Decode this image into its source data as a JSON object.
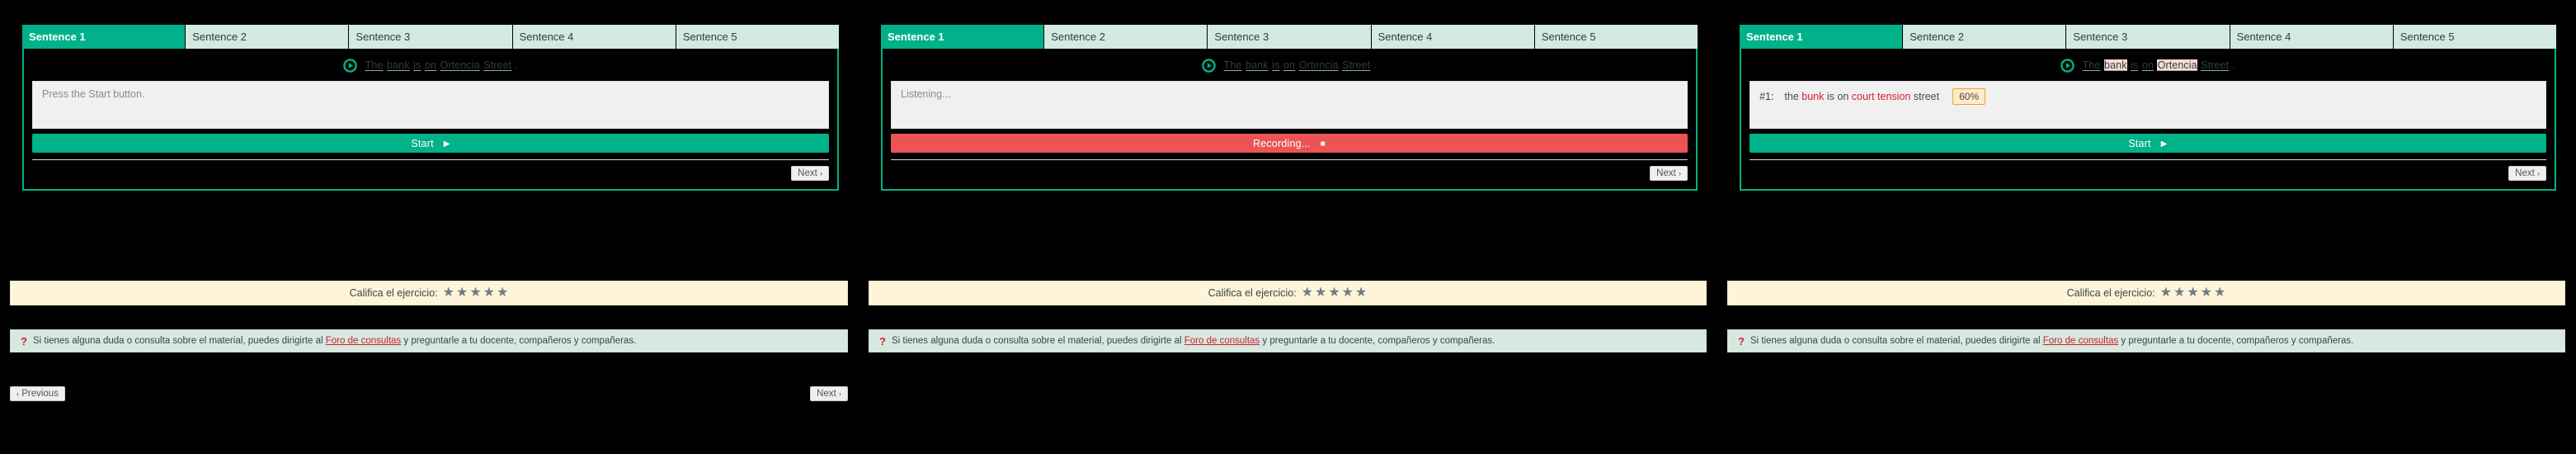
{
  "tabs": [
    {
      "label": "Sentence 1",
      "active": true
    },
    {
      "label": "Sentence 2",
      "active": false
    },
    {
      "label": "Sentence 3",
      "active": false
    },
    {
      "label": "Sentence 4",
      "active": false
    },
    {
      "label": "Sentence 5",
      "active": false
    }
  ],
  "prompt": {
    "play_icon": "play-circle-icon",
    "full_text": "The bank is on Ortencia Street .",
    "words": [
      "The",
      "bank",
      "is",
      "on",
      "Ortencia",
      "Street"
    ],
    "terminator": ".",
    "highlighted_words": [
      "bank",
      "Ortencia"
    ]
  },
  "panels": [
    {
      "state": "idle",
      "response_placeholder": "Press the Start button.",
      "action_label": "Start",
      "action_glyph": "▶",
      "action_icon": "play-icon",
      "next_label": "Next",
      "next_chevron": "›",
      "highlight": false,
      "show_result": false,
      "show_bottom_nav": true
    },
    {
      "state": "recording",
      "response_placeholder": "Listening...",
      "action_label": "Recording...",
      "action_glyph": "■",
      "action_icon": "stop-icon",
      "next_label": "Next",
      "next_chevron": "›",
      "highlight": false,
      "show_result": false,
      "show_bottom_nav": false
    },
    {
      "state": "result",
      "response_placeholder": "",
      "action_label": "Start",
      "action_glyph": "▶",
      "action_icon": "play-icon",
      "next_label": "Next",
      "next_chevron": "›",
      "highlight": true,
      "show_result": true,
      "show_bottom_nav": false,
      "result": {
        "index_label": "#1:",
        "score": "60%",
        "tokens": [
          {
            "text": "the",
            "error": false
          },
          {
            "text": "bunk",
            "error": true
          },
          {
            "text": "is",
            "error": false
          },
          {
            "text": "on",
            "error": false
          },
          {
            "text": "court",
            "error": true
          },
          {
            "text": "tension",
            "error": true
          },
          {
            "text": "street",
            "error": false
          }
        ]
      }
    }
  ],
  "rating": {
    "label": "Califica el ejercicio:",
    "star_glyph": "★",
    "star_count": 5,
    "filled": 0
  },
  "help": {
    "question_mark": "?",
    "text_before": "Si tienes alguna duda o consulta sobre el material, puedes dirigirte al",
    "link_label": "Foro de consultas",
    "text_after": "y preguntarle a tu docente, compañeros y compañeras."
  },
  "bottom_nav": {
    "previous_label": "Previous",
    "previous_chevron": "‹",
    "next_label": "Next",
    "next_chevron": "›"
  },
  "colors": {
    "background": "#000000",
    "accent_teal": "#00b189",
    "tab_inactive": "#d3e9e2",
    "recording_red": "#ea5455",
    "error_red": "#cf2030",
    "highlight_pink": "#fbd9d2",
    "badge_bg": "#fdebc8",
    "badge_border": "#e8a33d",
    "rating_bg": "#fdf4d9",
    "help_bg": "#d6e8e0"
  }
}
